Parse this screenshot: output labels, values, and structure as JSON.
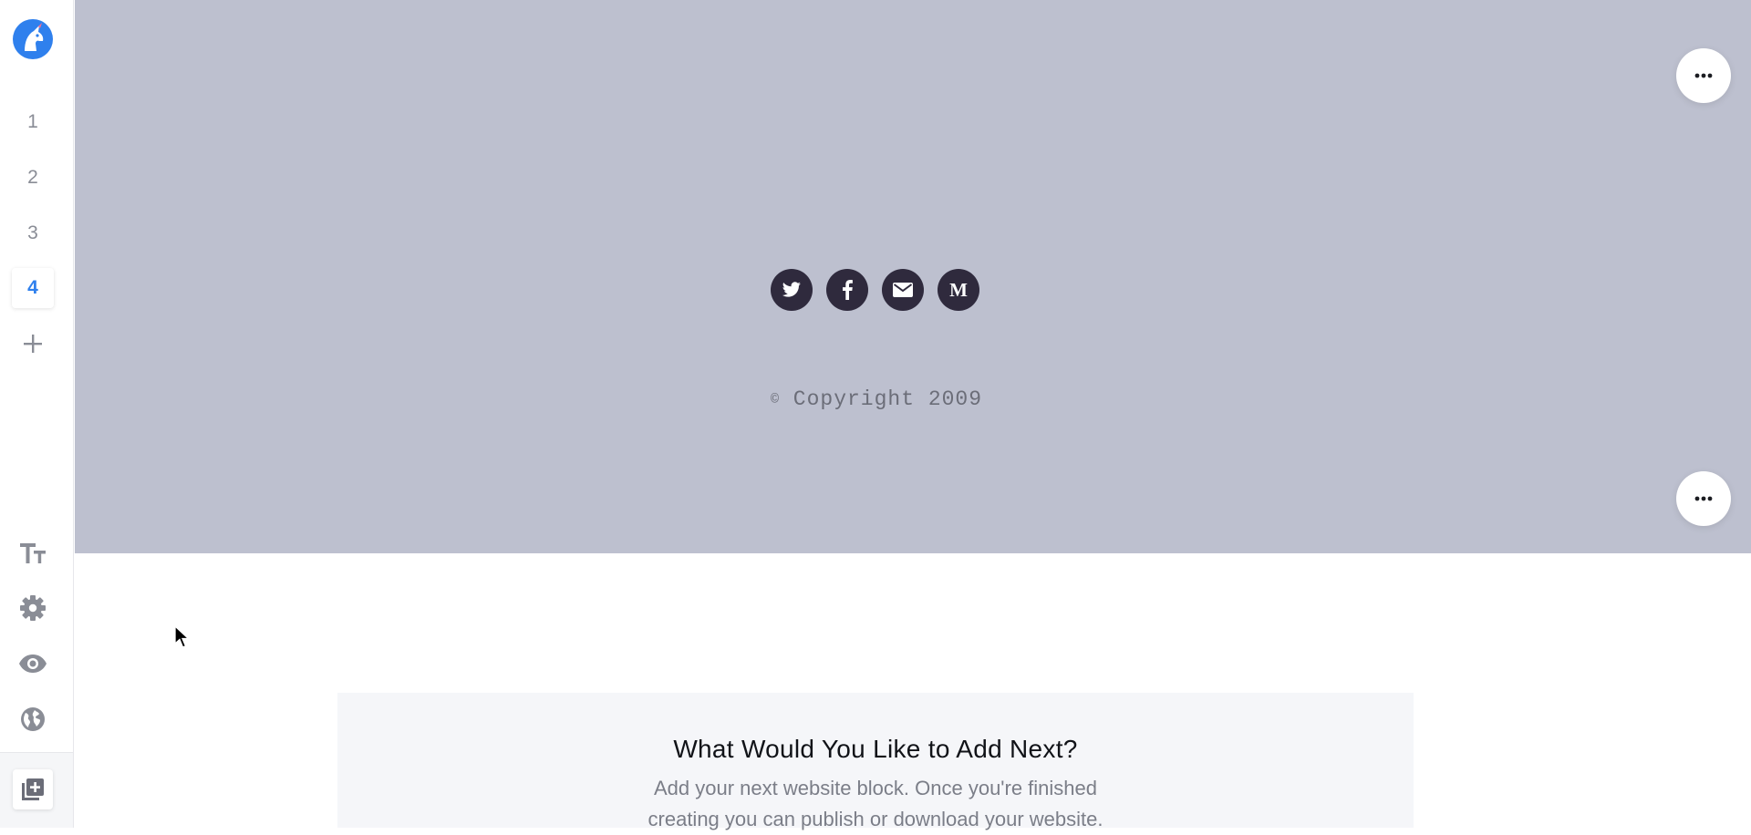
{
  "sidebar": {
    "logo_icon": "unicorn-logo-icon",
    "pages": [
      {
        "label": "1",
        "active": false
      },
      {
        "label": "2",
        "active": false
      },
      {
        "label": "3",
        "active": false
      },
      {
        "label": "4",
        "active": true
      }
    ],
    "add_page_icon": "plus-icon",
    "tools": [
      {
        "name": "typography",
        "icon": "text-size-icon"
      },
      {
        "name": "settings",
        "icon": "gear-icon"
      },
      {
        "name": "preview",
        "icon": "eye-icon"
      },
      {
        "name": "publish",
        "icon": "globe-icon"
      }
    ],
    "add_block_icon": "add-block-icon"
  },
  "footer_block": {
    "background": "#bdc0cf",
    "social_icons": [
      "twitter-icon",
      "facebook-icon",
      "email-icon",
      "medium-icon"
    ],
    "social_bg": "#2f2a3d",
    "copyright_symbol": "©",
    "copyright_text": "Copyright 2009"
  },
  "add_next": {
    "title": "What Would You Like to Add Next?",
    "description": "Add your next website block. Once you're finished creating you can publish or download your website."
  },
  "colors": {
    "accent": "#2f80ed",
    "muted": "#8a8d96"
  }
}
